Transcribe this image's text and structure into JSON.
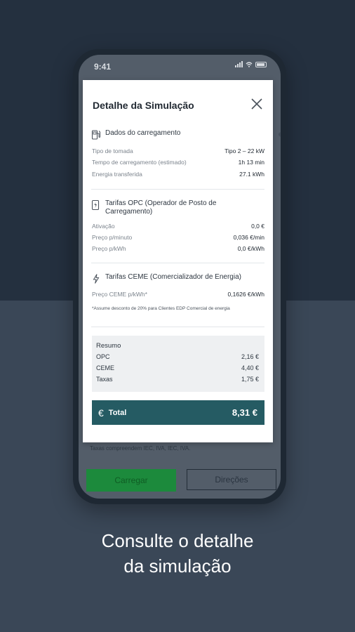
{
  "status": {
    "time": "9:41"
  },
  "modal": {
    "title": "Detalhe da Simulação",
    "section1": {
      "title": "Dados do carregamento",
      "icon": "fuel-pump-icon",
      "rows": [
        {
          "label": "Tipo de tomada",
          "value": "Tipo 2 – 22 kW"
        },
        {
          "label": "Tempo de carregamento (estimado)",
          "value": "1h 13 min"
        },
        {
          "label": "Energia transferida",
          "value": "27.1 kWh"
        }
      ]
    },
    "section2": {
      "title": "Tarifas OPC (Operador de Posto de Carregamento)",
      "icon": "charging-station-icon",
      "rows": [
        {
          "label": "Ativação",
          "value": "0,0 €"
        },
        {
          "label": "Preço p/minuto",
          "value": "0,036 €/min"
        },
        {
          "label": "Preço p/kWh",
          "value": "0,0 €/kWh"
        }
      ]
    },
    "section3": {
      "title": "Tarifas CEME (Comercializador de Energia)",
      "icon": "lightning-icon",
      "rows": [
        {
          "label": "Preço CEME p/kWh*",
          "value": "0,1626 €/kWh"
        }
      ],
      "footnote": "*Assume desconto de 20% para Clientes EDP Comercial de energia"
    },
    "summary": {
      "title": "Resumo",
      "rows": [
        {
          "label": "OPC",
          "value": "2,16 €"
        },
        {
          "label": "CEME",
          "value": "4,40 €"
        },
        {
          "label": "Taxas",
          "value": "1,75 €"
        }
      ]
    },
    "total": {
      "label": "Total",
      "value": "8,31 €",
      "icon": "euro-icon"
    }
  },
  "background": {
    "note": "Taxas compreendem IEC, IVA, IEC, IVA.",
    "carregar_label": "Carregar",
    "direcoes_label": "Direções"
  },
  "caption": {
    "line1": "Consulte o detalhe",
    "line2": "da simulação"
  },
  "colors": {
    "accent_total": "#255b63",
    "button_green": "#1c8a3c",
    "bg_dark": "#24303f"
  }
}
